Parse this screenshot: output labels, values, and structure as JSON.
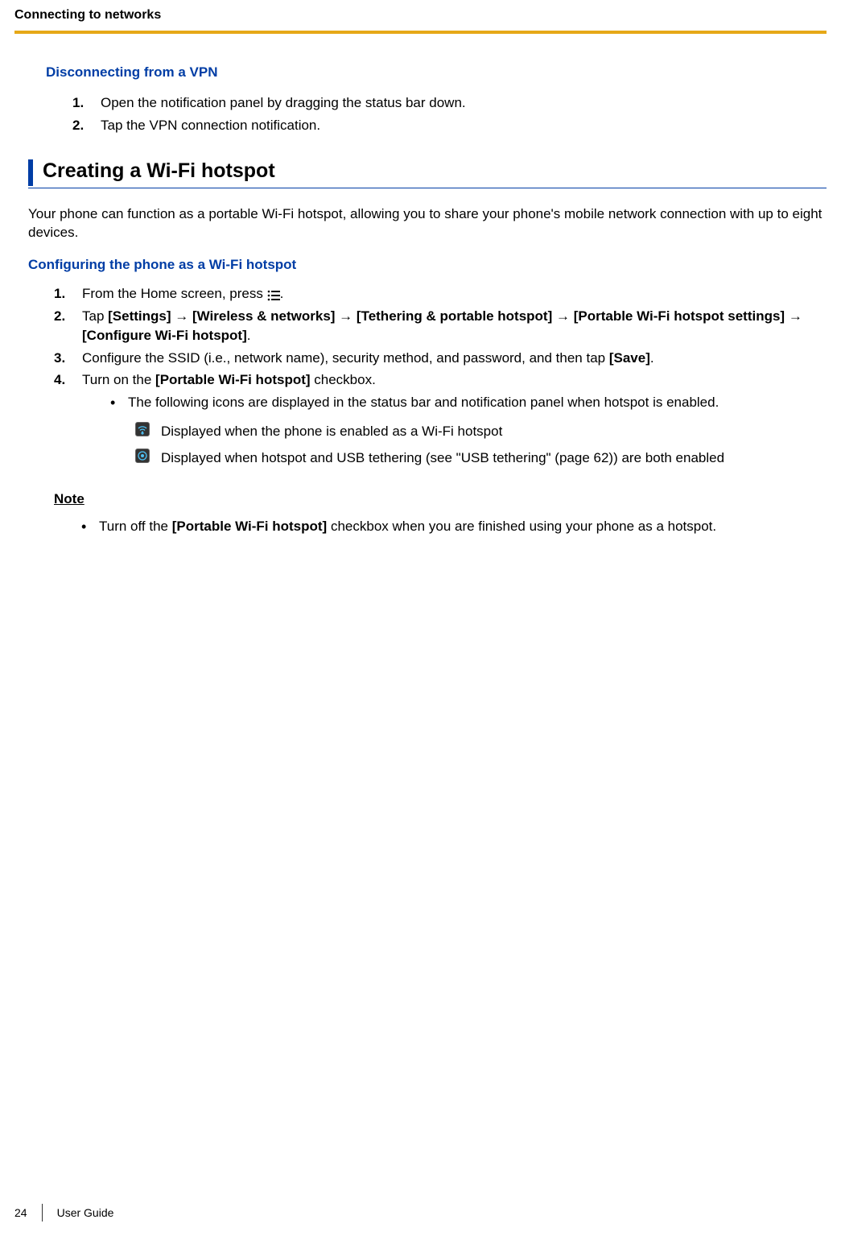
{
  "header": {
    "title": "Connecting to networks"
  },
  "section1": {
    "heading": "Disconnecting from a VPN",
    "steps": [
      {
        "num": "1.",
        "text": "Open the notification panel by dragging the status bar down."
      },
      {
        "num": "2.",
        "text": "Tap the VPN connection notification."
      }
    ]
  },
  "section2": {
    "heading": "Creating a Wi-Fi hotspot",
    "intro": "Your phone can function as a portable Wi-Fi hotspot, allowing you to share your phone's mobile network connection with up to eight devices.",
    "subheading": "Configuring the phone as a Wi-Fi hotspot",
    "steps": {
      "s1": {
        "num": "1.",
        "prefix": "From the Home screen, press ",
        "suffix": "."
      },
      "s2": {
        "num": "2.",
        "prefix": "Tap ",
        "b1": "[Settings]",
        "a1": " → ",
        "b2": "[Wireless & networks]",
        "a2": " → ",
        "b3": "[Tethering & portable hotspot]",
        "a3": " → ",
        "b4": "[Portable Wi-Fi hotspot settings]",
        "a4": " → ",
        "b5": "[Configure Wi-Fi hotspot]",
        "suffix": "."
      },
      "s3": {
        "num": "3.",
        "prefix": "Configure the SSID (i.e., network name), security method, and password, and then tap ",
        "b1": "[Save]",
        "suffix": "."
      },
      "s4": {
        "num": "4.",
        "prefix": "Turn on the ",
        "b1": "[Portable Wi-Fi hotspot]",
        "suffix": " checkbox."
      },
      "s4bullet": "The following icons are displayed in the status bar and notification panel when hotspot is enabled."
    },
    "icons": {
      "row1": "Displayed when the phone is enabled as a Wi-Fi hotspot",
      "row2": "Displayed when hotspot and USB tethering (see \"USB tethering\" (page 62)) are both enabled"
    },
    "note": {
      "heading": "Note",
      "bullet_prefix": "Turn off the ",
      "bullet_bold": "[Portable Wi-Fi hotspot]",
      "bullet_suffix": " checkbox when you are finished using your phone as a hotspot."
    }
  },
  "footer": {
    "page": "24",
    "title": "User Guide"
  }
}
